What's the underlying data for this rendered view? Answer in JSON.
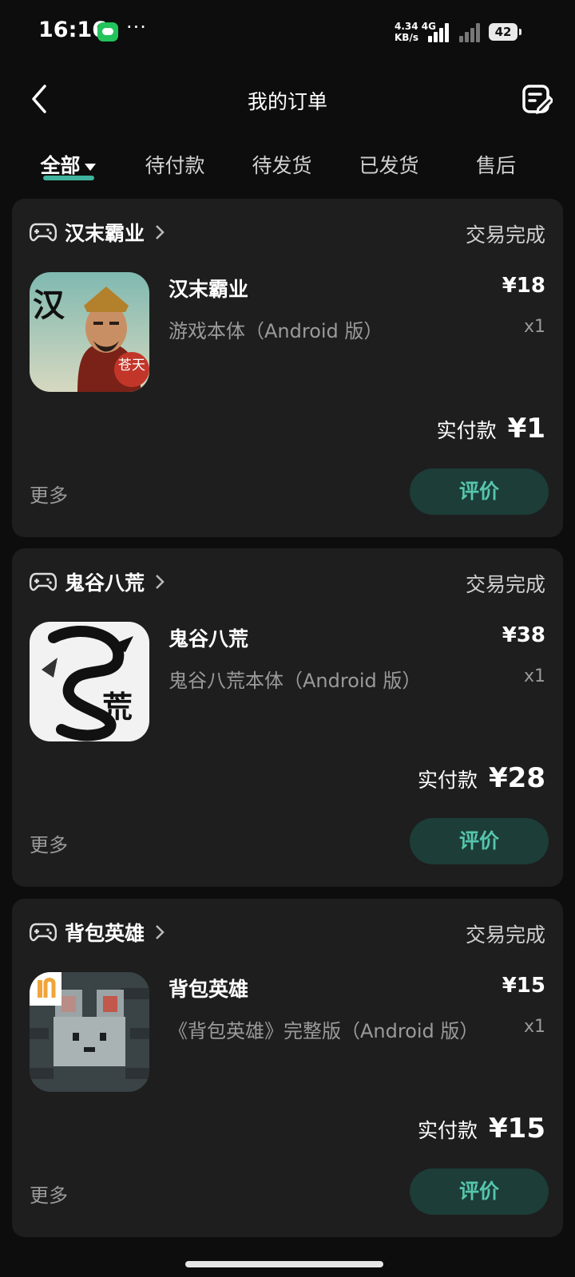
{
  "status": {
    "time": "16:16",
    "dots": "···",
    "net_speed_line1": "4.34 4G",
    "net_speed_line2": "KB/s",
    "battery": "42"
  },
  "nav": {
    "title": "我的订单"
  },
  "tabs": [
    {
      "label": "全部"
    },
    {
      "label": "待付款"
    },
    {
      "label": "待发货"
    },
    {
      "label": "已发货"
    },
    {
      "label": "售后"
    }
  ],
  "orders": [
    {
      "shop": "汉末霸业",
      "status": "交易完成",
      "product_name": "汉末霸业",
      "price": "¥18",
      "spec": "游戏本体（Android 版）",
      "qty": "x1",
      "paid_label": "实付款",
      "paid_amount": "¥1",
      "more": "更多",
      "review": "评价",
      "thumb_text_1": "汉",
      "thumb_text_2": "苍天"
    },
    {
      "shop": "鬼谷八荒",
      "status": "交易完成",
      "product_name": "鬼谷八荒",
      "price": "¥38",
      "spec": "鬼谷八荒本体（Android 版）",
      "qty": "x1",
      "paid_label": "实付款",
      "paid_amount": "¥28",
      "more": "更多",
      "review": "评价",
      "thumb_text_1": "荒"
    },
    {
      "shop": "背包英雄",
      "status": "交易完成",
      "product_name": "背包英雄",
      "price": "¥15",
      "spec": "《背包英雄》完整版（Android 版）",
      "qty": "x1",
      "paid_label": "实付款",
      "paid_amount": "¥15",
      "more": "更多",
      "review": "评价"
    }
  ]
}
